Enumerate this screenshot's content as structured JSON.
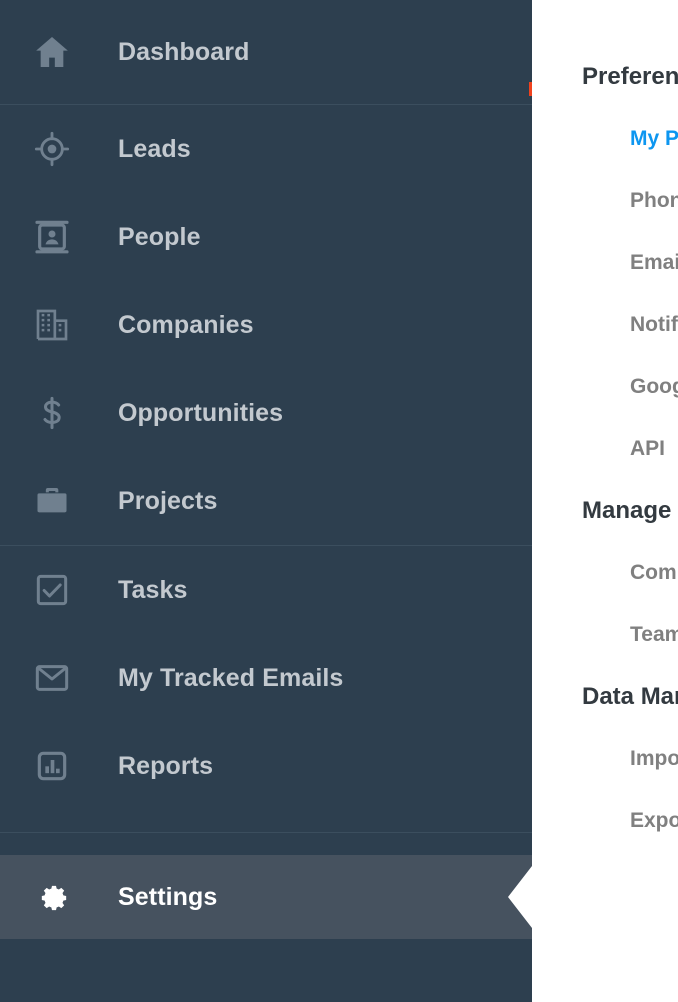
{
  "sidebar": {
    "background_color": "#2d3f4f",
    "active_background_color": "#46525f",
    "label_color": "#c3c9cf",
    "icon_color": "#70808f",
    "groups": [
      {
        "items": [
          {
            "label": "Dashboard",
            "icon": "home-icon",
            "key": "dashboard"
          }
        ]
      },
      {
        "items": [
          {
            "label": "Leads",
            "icon": "target-icon",
            "key": "leads"
          },
          {
            "label": "People",
            "icon": "contact-card-icon",
            "key": "people"
          },
          {
            "label": "Companies",
            "icon": "building-icon",
            "key": "companies"
          },
          {
            "label": "Opportunities",
            "icon": "dollar-icon",
            "key": "opportunities"
          },
          {
            "label": "Projects",
            "icon": "briefcase-icon",
            "key": "projects"
          }
        ]
      },
      {
        "items": [
          {
            "label": "Tasks",
            "icon": "checkbox-icon",
            "key": "tasks"
          },
          {
            "label": "My Tracked Emails",
            "icon": "envelope-icon",
            "key": "my-tracked-emails"
          },
          {
            "label": "Reports",
            "icon": "bar-chart-icon",
            "key": "reports"
          }
        ]
      },
      {
        "items": [
          {
            "label": "Settings",
            "icon": "gear-icon",
            "key": "settings",
            "active": true
          }
        ]
      }
    ],
    "notification_badge_color": "#f0421e"
  },
  "settings_panel": {
    "selected_color": "#0d96f0",
    "heading_color": "#333a40",
    "item_color": "#808080",
    "sections": [
      {
        "title": "Preferences",
        "items": [
          {
            "label": "My Profile",
            "selected": true
          },
          {
            "label": "Phone",
            "selected": false
          },
          {
            "label": "Email",
            "selected": false
          },
          {
            "label": "Notifications",
            "selected": false
          },
          {
            "label": "Google Sync",
            "selected": false
          },
          {
            "label": "API",
            "selected": false
          }
        ]
      },
      {
        "title": "Manage",
        "items": [
          {
            "label": "Company",
            "selected": false
          },
          {
            "label": "Team",
            "selected": false
          }
        ]
      },
      {
        "title": "Data Management",
        "items": [
          {
            "label": "Import",
            "selected": false
          },
          {
            "label": "Export",
            "selected": false
          }
        ]
      }
    ]
  }
}
